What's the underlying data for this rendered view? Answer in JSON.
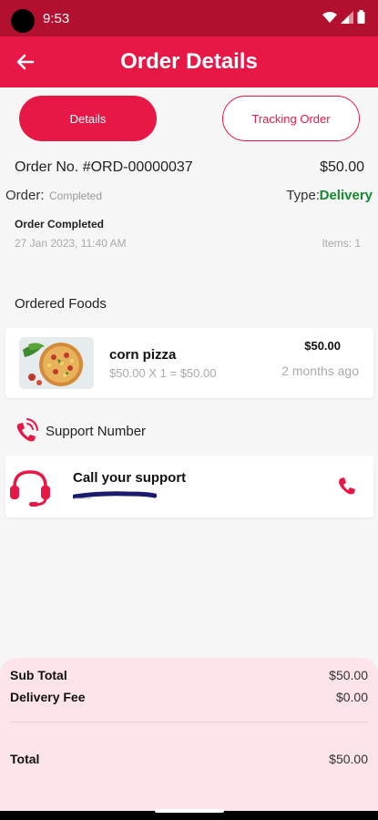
{
  "status_bar": {
    "time": "9:53"
  },
  "header": {
    "title": "Order Details"
  },
  "tabs": [
    {
      "label": "Details",
      "active": true
    },
    {
      "label": "Tracking Order",
      "active": false
    }
  ],
  "order": {
    "number": "Order No. #ORD-00000037",
    "total": "$50.00",
    "status_label": "Order:",
    "status": "Completed",
    "type_label": "Type:",
    "type": "Delivery",
    "completed_title": "Order Completed",
    "date": "27 Jan 2023, 11:40 AM",
    "items": "Items: 1"
  },
  "ordered_foods": {
    "title": "Ordered Foods",
    "items": [
      {
        "name": "corn pizza",
        "qty": "$50.00 X 1 = $50.00",
        "price": "$50.00",
        "time": "2 months ago"
      }
    ]
  },
  "support": {
    "title": "Support Number",
    "card_title": "Call your support"
  },
  "summary": {
    "subtotal_label": "Sub Total",
    "subtotal": "$50.00",
    "delivery_label": "Delivery Fee",
    "delivery": "$0.00",
    "total_label": "Total",
    "total": "$50.00"
  },
  "colors": {
    "primary": "#e81846",
    "status_bar": "#b30f2e",
    "delivery_green": "#138a2c",
    "summary_bg": "#fde4e8"
  }
}
